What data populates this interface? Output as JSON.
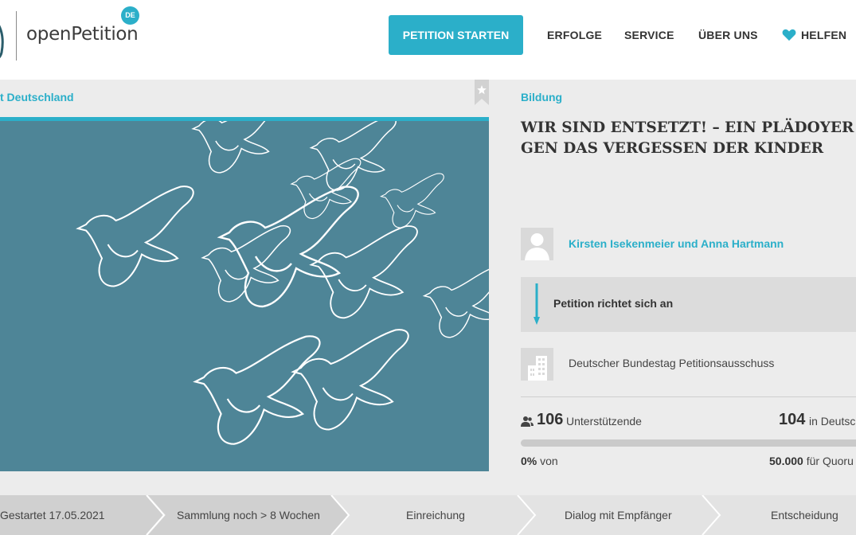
{
  "header": {
    "logo_text": "openPetition",
    "logo_badge": "DE",
    "start_button": "PETITION STARTEN",
    "nav": [
      "ERFOLGE",
      "SERVICE",
      "ÜBER UNS",
      "HELFEN"
    ]
  },
  "breadcrumb": "t Deutschland",
  "category": "Bildung",
  "title_line1": "WIR SIND ENTSETZT! – EIN PLÄDOYER GE",
  "title_line2": "GEN DAS VERGESSEN DER KINDER",
  "authors": "Kirsten Isekenmeier und Anna Hartmann",
  "target_label": "Petition richtet sich an",
  "recipient": "Deutscher Bundestag Petitionsausschuss",
  "stats": {
    "supporters_count": "106",
    "supporters_label": "Unterstützende",
    "region_count": "104",
    "region_label": "in Deutsc",
    "progress_fraction": 0.0,
    "percent": "0%",
    "percent_suffix": "von",
    "quorum_value": "50.000",
    "quorum_label": "für Quoru"
  },
  "steps": [
    "Gestartet 17.05.2021",
    "Sammlung noch > 8 Wochen",
    "Einreichung",
    "Dialog mit Empfänger",
    "Entscheidung"
  ],
  "colors": {
    "accent": "#2bafc9",
    "image_bg": "#4e8597",
    "page_bg": "#ececec"
  }
}
